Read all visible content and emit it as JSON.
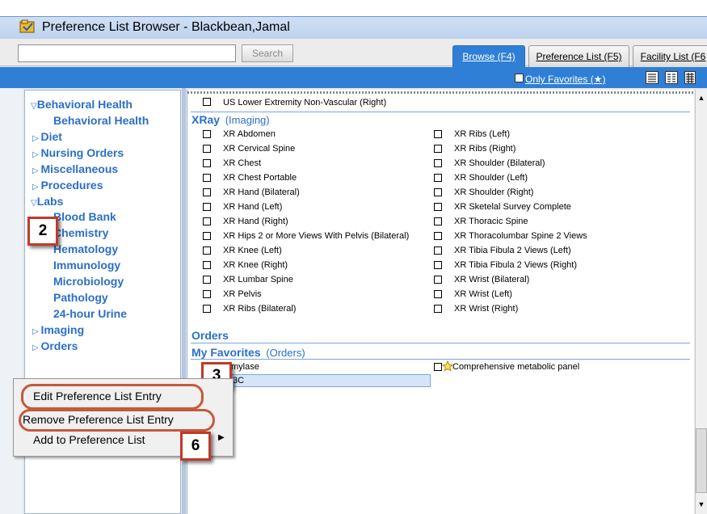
{
  "window": {
    "title": "Preference List Browser - Blackbean,Jamal"
  },
  "toolbar": {
    "search_value": "",
    "search_button": "Search",
    "tabs": [
      "Browse (F4)",
      "Preference List (F5)",
      "Facility List (F6"
    ]
  },
  "filter": {
    "only_favorites_label": "Only Favorites (★)"
  },
  "tree": {
    "behavioral_health": "Behavioral Health",
    "behavioral_health_child": "Behavioral Health",
    "diet": "Diet",
    "nursing_orders": "Nursing Orders",
    "miscellaneous": "Miscellaneous",
    "procedures": "Procedures",
    "labs": "Labs",
    "labs_children": [
      "Blood Bank",
      "Chemistry",
      "Hematology",
      "Immunology",
      "Microbiology",
      "Pathology",
      "24-hour Urine"
    ],
    "imaging": "Imaging",
    "orders": "Orders"
  },
  "content": {
    "top_item": "US Lower Extremity Non-Vascular (Right)",
    "xray_header": "XRay",
    "xray_sub": "(Imaging)",
    "xray_left": [
      "XR Abdomen",
      "XR Cervical Spine",
      "XR Chest",
      "XR Chest Portable",
      "XR Hand (Bilateral)",
      "XR Hand (Left)",
      "XR Hand (Right)",
      "XR Hips 2 or More Views With Pelvis (Bilateral)",
      "XR Knee (Left)",
      "XR Knee (Right)",
      "XR Lumbar Spine",
      "XR Pelvis",
      "XR Ribs (Bilateral)"
    ],
    "xray_right": [
      "XR Ribs (Left)",
      "XR Ribs (Right)",
      "XR Shoulder (Bilateral)",
      "XR Shoulder (Left)",
      "XR Shoulder (Right)",
      "XR Sketelal Survey Complete",
      "XR Thoracic Spine",
      "XR Thoracolumbar Spine 2 Views",
      "XR Tibia Fibula 2 Views (Left)",
      "XR Tibia Fibula 2 Views (Right)",
      "XR Wrist (Bilateral)",
      "XR Wrist (Left)",
      "XR Wrist (Right)"
    ],
    "orders_header": "Orders",
    "favorites_header": "My Favorites",
    "favorites_sub": "(Orders)",
    "favorites_left": [
      "mylase",
      "3C"
    ],
    "favorites_right": "Comprehensive metabolic panel"
  },
  "context_menu": {
    "edit": "Edit Preference List Entry",
    "remove": "Remove Preference List Entry",
    "add": "Add to Preference List"
  },
  "callouts": {
    "c2": "2",
    "c3": "3",
    "c6": "6"
  },
  "colors": {
    "accent_blue": "#2f7fd6",
    "link_blue": "#2a6fc9",
    "callout_red": "#c0392b"
  }
}
